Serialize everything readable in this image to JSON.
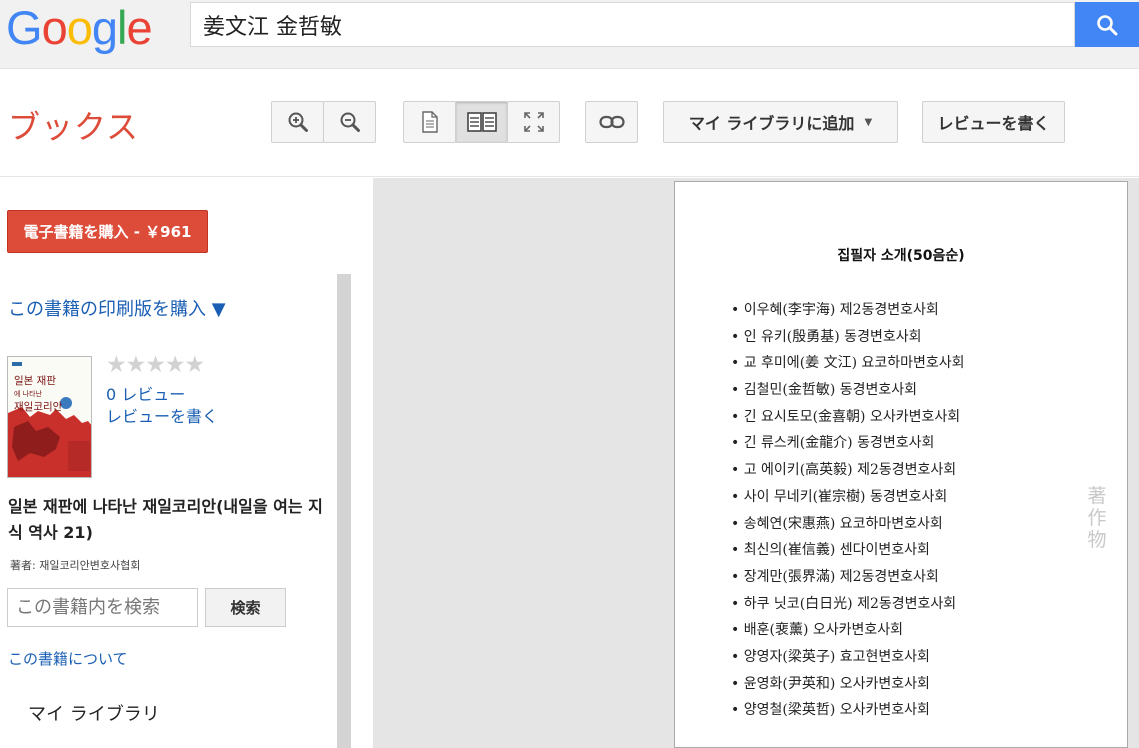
{
  "header": {
    "logo_letters": [
      {
        "char": "G",
        "color": "#4285f4"
      },
      {
        "char": "o",
        "color": "#ea4335"
      },
      {
        "char": "o",
        "color": "#fbbc05"
      },
      {
        "char": "g",
        "color": "#4285f4"
      },
      {
        "char": "l",
        "color": "#34a853"
      },
      {
        "char": "e",
        "color": "#ea4335"
      }
    ],
    "search_value": "姜文江 金哲敏",
    "search_icon": "search-icon",
    "search_button_color": "#4285f4"
  },
  "toolbar": {
    "section_title": "ブックス",
    "zoom_in_icon": "zoom-in-icon",
    "zoom_out_icon": "zoom-out-icon",
    "single_page_icon": "single-page-icon",
    "two_page_icon": "two-page-icon",
    "fullscreen_icon": "fullscreen-icon",
    "link_icon": "link-icon",
    "add_library_label": "マイ ライブラリに追加",
    "write_review_label": "レビューを書く"
  },
  "sidebar": {
    "buy_ebook_label": "電子書籍を購入 - ￥961",
    "buy_print_label": "この書籍の印刷版を購入 ▼",
    "rating_stars": "★★★★★",
    "rating_value": 0,
    "reviews_count_label": "0 レビュー",
    "write_review_label": "レビューを書く",
    "book_title": "일본 재판에 나타난 재일코리안(내일을 여는 지식 역사 21)",
    "author_line": "著者: 재일코리안변호사협회",
    "inbook_search_placeholder": "この書籍内を検索",
    "inbook_search_button": "検索",
    "about_book_label": "この書籍について",
    "my_library_label": "マイ ライブラリ",
    "cover": {
      "title_line1": "일본 재판",
      "title_line2": "에 나타난",
      "title_line3": "재일코리안"
    }
  },
  "page": {
    "heading": "집필자 소개(50음순)",
    "items": [
      "이우혜(李宇海) 제2동경변호사회",
      "인 유키(殷勇基) 동경변호사회",
      "교 후미에(姜 文江) 요코하마변호사회",
      "김철민(金哲敏) 동경변호사회",
      "긴 요시토모(金喜朝) 오사카변호사회",
      "긴 류스케(金龍介) 동경변호사회",
      "고 에이키(高英毅) 제2동경변호사회",
      "사이 무네키(崔宗樹) 동경변호사회",
      "송혜연(宋惠燕) 요코하마변호사회",
      "최신의(崔信義) 센다이변호사회",
      "장계만(張界滿) 제2동경변호사회",
      "하쿠 닛코(白日光) 제2동경변호사회",
      "배훈(裵薰) 오사카변호사회",
      "양영자(梁英子) 효고현변호사회",
      "윤영화(尹英和) 오사카변호사회",
      "양영철(梁英哲) 오사카변호사회"
    ],
    "watermark": "著作物"
  }
}
